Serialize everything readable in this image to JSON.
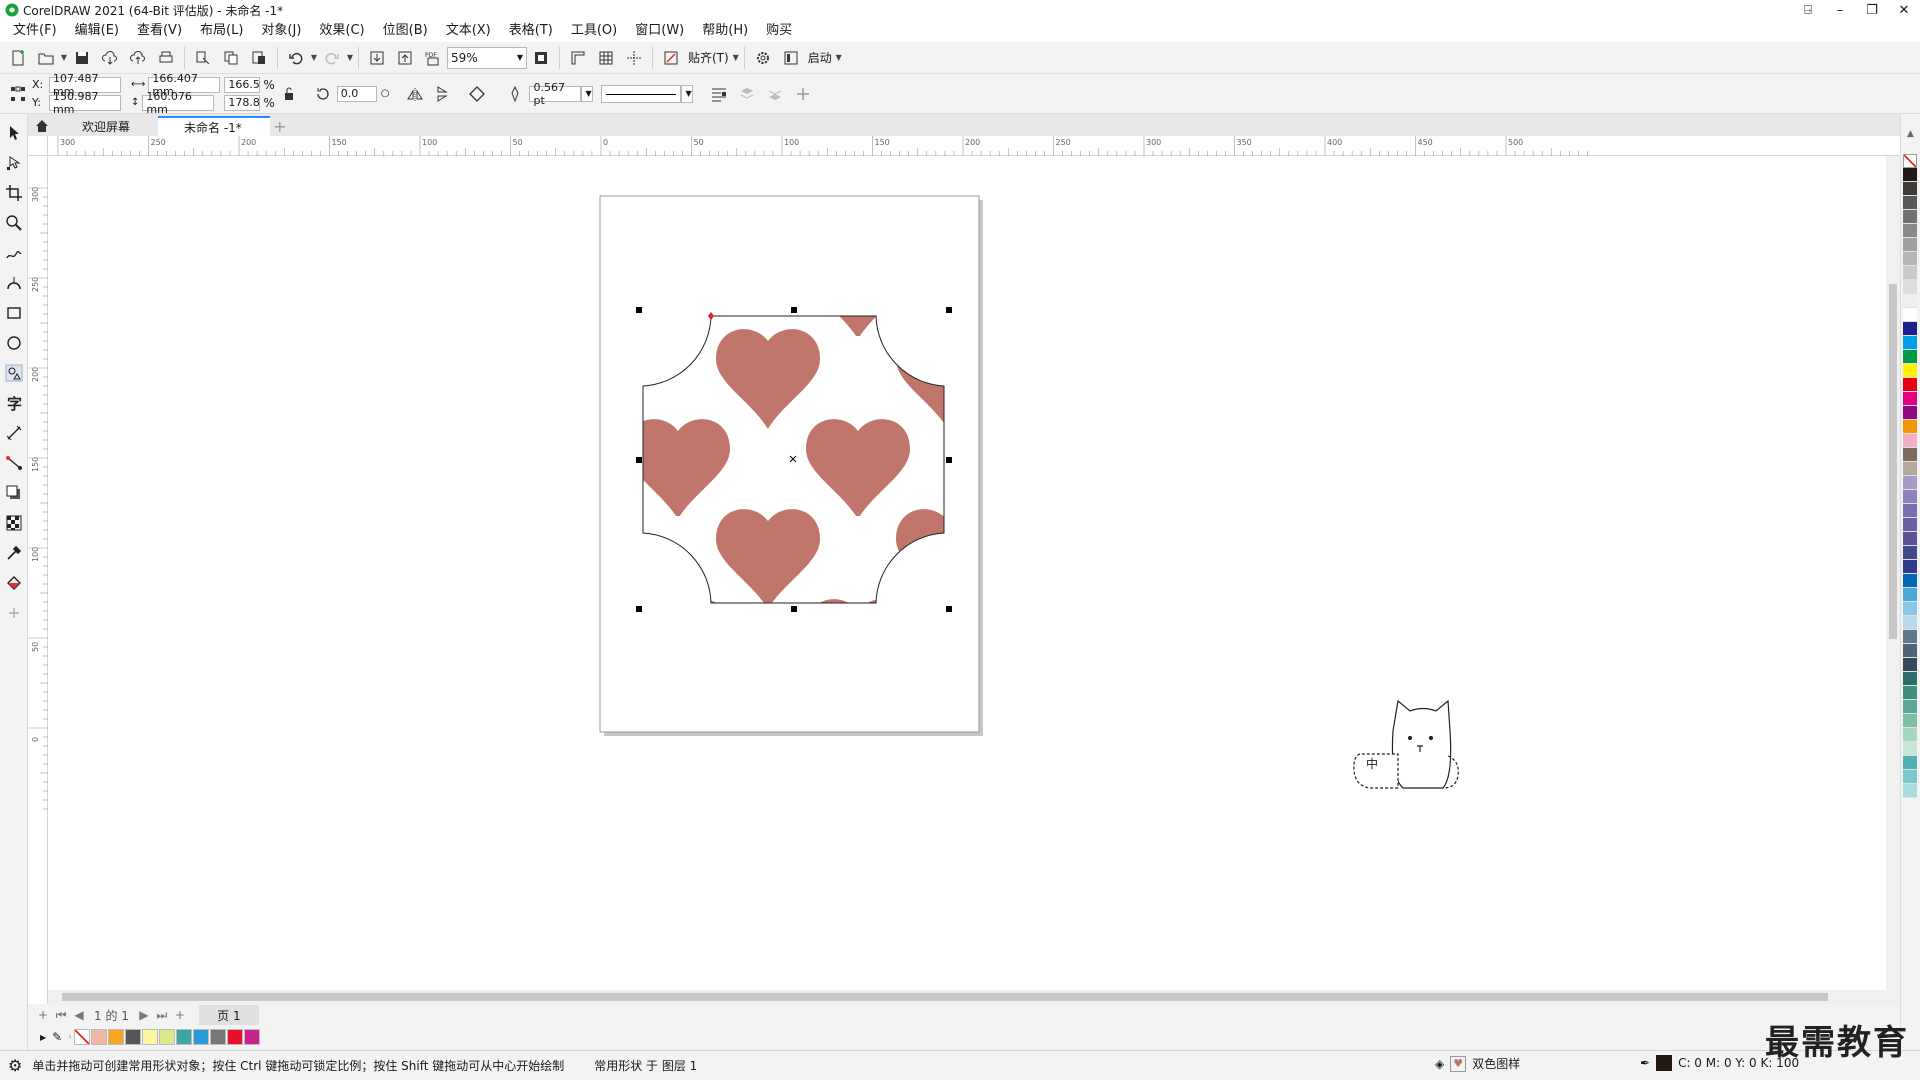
{
  "window": {
    "title": "CorelDRAW 2021 (64-Bit 评估版) - 未命名 -1*"
  },
  "menu": [
    "文件(F)",
    "编辑(E)",
    "查看(V)",
    "布局(L)",
    "对象(J)",
    "效果(C)",
    "位图(B)",
    "文本(X)",
    "表格(T)",
    "工具(O)",
    "窗口(W)",
    "帮助(H)",
    "购买"
  ],
  "std_toolbar": {
    "zoom_value": "59%",
    "snap_label": "贴齐(T)",
    "launch_label": "启动",
    "pdf_label": "PDF"
  },
  "property_bar": {
    "x_label": "X:",
    "y_label": "Y:",
    "x_value": "107.487 mm",
    "y_value": "150.987 mm",
    "width_value": "166.407 mm",
    "height_value": "160.076 mm",
    "scale_w": "166.5",
    "scale_h": "178.8",
    "percent": "%",
    "rotation": "0.0",
    "outline_width": "0.567 pt"
  },
  "tabs": {
    "welcome": "欢迎屏幕",
    "document": "未命名 -1*"
  },
  "ruler_h_labels": [
    "300",
    "250",
    "200",
    "150",
    "100",
    "50",
    "0",
    "50",
    "100",
    "150",
    "200",
    "250",
    "300",
    "350",
    "400",
    "450",
    "500"
  ],
  "ruler_v_labels": [
    "300",
    "250",
    "200",
    "150",
    "100",
    "50",
    "0"
  ],
  "page_nav": {
    "counter": "1 的 1",
    "page_tab": "页 1"
  },
  "doc_palette_colors": [
    "#f4b6a4",
    "#f5a623",
    "#555555",
    "#fff7a0",
    "#d8e88a",
    "#3aa7a2",
    "#2b9bd7",
    "#777777",
    "#e8112d",
    "#c8238a"
  ],
  "palette_colors": [
    "#231815",
    "#3e3a39",
    "#595757",
    "#727171",
    "#898989",
    "#9fa0a0",
    "#b5b5b6",
    "#c9caca",
    "#dcdddd",
    "#efefef",
    "#ffffff",
    "#1d2088",
    "#00a0e9",
    "#009944",
    "#fff100",
    "#e60012",
    "#e4007f",
    "#920783",
    "#f39800",
    "#f6adc6",
    "#7d6b5d",
    "#b3a8a0",
    "#a59aca",
    "#8f82bc",
    "#7a6db0",
    "#6b5ea5",
    "#5c5195",
    "#414a8c",
    "#2e3a8a",
    "#0068b7",
    "#4aa8d8",
    "#88c7e8",
    "#b7d9ea",
    "#61778a",
    "#4d6478",
    "#34495e",
    "#2f6b6a",
    "#3f8f7f",
    "#5aa795",
    "#7fbfa8",
    "#a6d6c0",
    "#c8e6d7",
    "#4fb0b5",
    "#7ac8cc",
    "#a9dcde"
  ],
  "status": {
    "message": "单击并拖动可创建常用形状对象；按住 Ctrl 键拖动可锁定比例；按住 Shift 键拖动可从中心开始绘制",
    "object": "常用形状 于 图层 1",
    "fill_label": "双色图样",
    "color_readout": "C: 0 M: 0 Y: 0 K: 100"
  },
  "watermark": "最需教育",
  "sticker_text": "中"
}
